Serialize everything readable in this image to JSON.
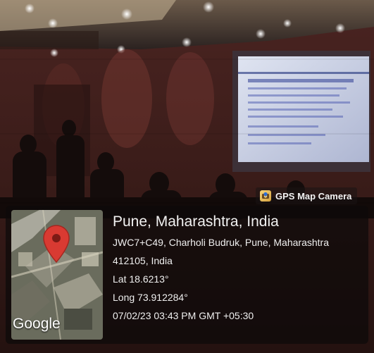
{
  "badge": {
    "label": "GPS Map Camera",
    "icon": "gps-camera-app-icon"
  },
  "location": {
    "place": "Pune, Maharashtra, India",
    "address_line1": "JWC7+C49, Charholi Budruk, Pune, Maharashtra",
    "address_line2": "412105, India",
    "lat": "Lat 18.6213°",
    "long": "Long 73.912284°",
    "datetime": "07/02/23 03:43 PM GMT +05:30"
  },
  "map": {
    "logo": "Google",
    "pin_color": "#d93a32"
  }
}
